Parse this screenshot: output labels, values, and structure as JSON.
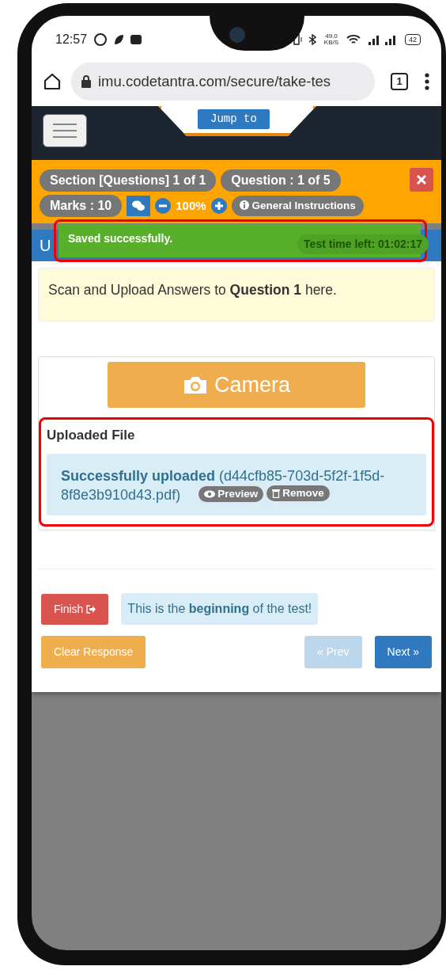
{
  "status_bar": {
    "time": "12:57",
    "speed": "49.0 KB/S",
    "battery": "42"
  },
  "browser": {
    "url": "imu.codetantra.com/secure/take-tes",
    "tab_count": "1"
  },
  "navbar": {
    "jump_button": "Jump to"
  },
  "info_bar": {
    "badges": [
      "Section [Questions] 1 of 1",
      "Question : 1 of 5",
      "Marks : 10"
    ],
    "zoom": "100%",
    "instructions": "General Instructions"
  },
  "panel": {
    "title": "U",
    "timer": "Test time left: 01:02:17"
  },
  "toast": "Saved successfully.",
  "prompt": "Scan and Upload Answers to **Question 1** here.",
  "camera_button": "Camera",
  "upload": {
    "heading": "Uploaded File",
    "status": "**Successfully uploaded** (d44cfb85-703d-5f2f-1f5d-8f8e3b910d43.pdf)",
    "preview": "Preview",
    "remove": "Remove"
  },
  "footer": {
    "finish": "Finish",
    "message": "This is the **beginning** of the test!",
    "clear": "Clear Response",
    "nav": [
      {
        "label": "« Prev",
        "disabled": true
      },
      {
        "label": "Next »",
        "disabled": false
      }
    ]
  }
}
